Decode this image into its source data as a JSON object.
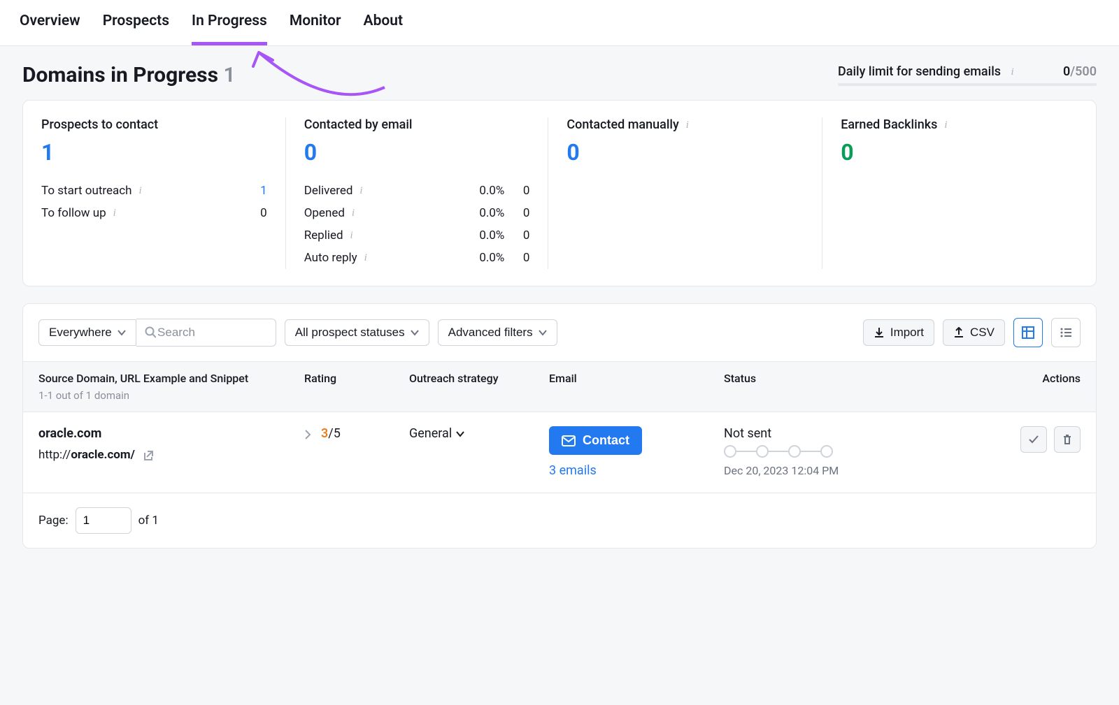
{
  "tabs": [
    "Overview",
    "Prospects",
    "In Progress",
    "Monitor",
    "About"
  ],
  "activeTab": 2,
  "pageTitle": "Domains in Progress",
  "pageCount": "1",
  "dailyLimit": {
    "label": "Daily limit for sending emails",
    "value": "0",
    "max": "/500"
  },
  "stats": {
    "prospects": {
      "title": "Prospects to contact",
      "big": "1",
      "lines": [
        {
          "label": "To start outreach",
          "val": "1",
          "link": true
        },
        {
          "label": "To follow up",
          "val": "0"
        }
      ]
    },
    "contacted": {
      "title": "Contacted by email",
      "big": "0",
      "lines": [
        {
          "label": "Delivered",
          "pct": "0.0%",
          "val": "0"
        },
        {
          "label": "Opened",
          "pct": "0.0%",
          "val": "0"
        },
        {
          "label": "Replied",
          "pct": "0.0%",
          "val": "0"
        },
        {
          "label": "Auto reply",
          "pct": "0.0%",
          "val": "0"
        }
      ]
    },
    "manual": {
      "title": "Contacted manually",
      "big": "0"
    },
    "earned": {
      "title": "Earned Backlinks",
      "big": "0"
    }
  },
  "filters": {
    "everywhere": "Everywhere",
    "searchPlaceholder": "Search",
    "allStatuses": "All prospect statuses",
    "advanced": "Advanced filters",
    "import": "Import",
    "csv": "CSV"
  },
  "tableHeaders": {
    "source": "Source Domain, URL Example and Snippet",
    "subcount": "1-1 out of 1 domain",
    "rating": "Rating",
    "strategy": "Outreach strategy",
    "email": "Email",
    "status": "Status",
    "actions": "Actions"
  },
  "row": {
    "domain": "oracle.com",
    "urlPrefix": "http://",
    "urlBold": "oracle.com/",
    "ratingNum": "3",
    "ratingMax": "/5",
    "strategy": "General",
    "contactLabel": "Contact",
    "emailsLink": "3 emails",
    "statusLabel": "Not sent",
    "statusDate": "Dec 20, 2023 12:04 PM"
  },
  "pagination": {
    "label": "Page:",
    "value": "1",
    "of": "of 1"
  }
}
